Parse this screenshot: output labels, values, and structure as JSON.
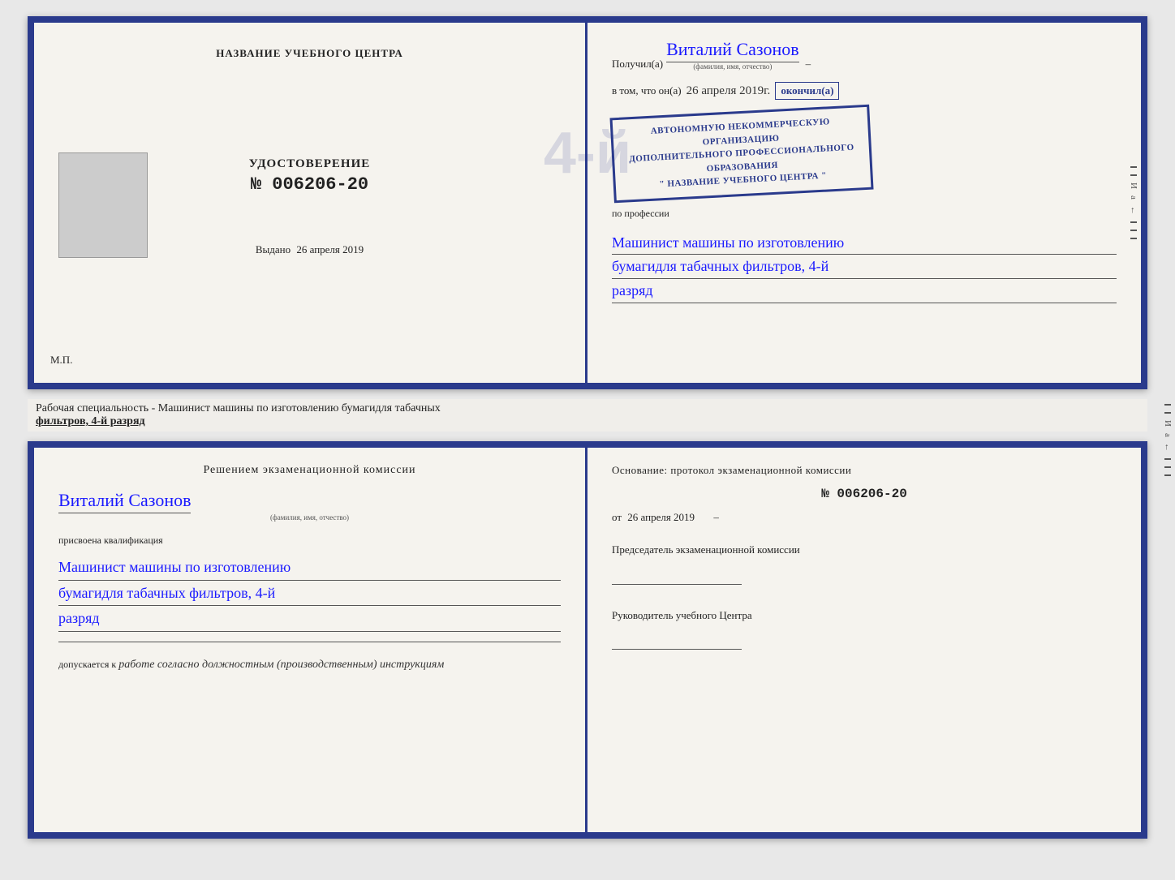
{
  "diploma": {
    "left": {
      "title": "НАЗВАНИЕ УЧЕБНОГО ЦЕНТРА",
      "cert_heading": "УДОСТОВЕРЕНИЕ",
      "cert_number": "№ 006206-20",
      "issued_label": "Выдано",
      "issued_date": "26 апреля 2019",
      "mp_label": "М.П."
    },
    "right": {
      "recipient_prefix": "Получил(а)",
      "recipient_name": "Виталий Сазонов",
      "recipient_subtitle": "(фамилия, имя, отчество)",
      "date_prefix": "в том, что он(а)",
      "date_value": "26 апреля 2019г.",
      "finished_label": "окончил(а)",
      "stamp_line1": "АВТОНОМНУЮ НЕКОММЕРЧЕСКУЮ ОРГАНИЗАЦИЮ",
      "stamp_line2": "ДОПОЛНИТЕЛЬНОГО ПРОФЕССИОНАЛЬНОГО ОБРАЗОВАНИЯ",
      "stamp_line3": "\" НАЗВАНИЕ УЧЕБНОГО ЦЕНТРА \"",
      "profession_label": "по профессии",
      "profession_line1": "Машинист машины по изготовлению",
      "profession_line2": "бумагидля табачных фильтров, 4-й",
      "profession_line3": "разряд"
    }
  },
  "middle": {
    "text": "Рабочая специальность - Машинист машины по изготовлению бумагидля табачных",
    "text2": "фильтров, 4-й разряд"
  },
  "bottom": {
    "left": {
      "section_title": "Решением  экзаменационной  комиссии",
      "person_name": "Виталий Сазонов",
      "person_subtitle": "(фамилия, имя, отчество)",
      "qualification_label": "присвоена квалификация",
      "qual_line1": "Машинист машины по изготовлению",
      "qual_line2": "бумагидля табачных фильтров, 4-й",
      "qual_line3": "разряд",
      "admission_prefix": "допускается к",
      "admission_text": "работе согласно должностным (производственным) инструкциям"
    },
    "right": {
      "basis_label": "Основание:  протокол  экзаменационной  комиссии",
      "protocol_number": "№  006206-20",
      "date_prefix": "от",
      "date_value": "26 апреля 2019",
      "chairman_title": "Председатель экзаменационной комиссии",
      "director_title": "Руководитель учебного Центра"
    }
  }
}
